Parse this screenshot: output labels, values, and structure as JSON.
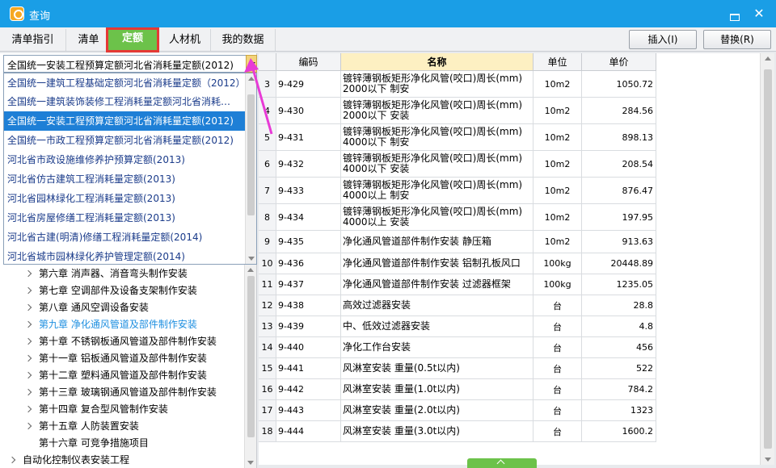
{
  "window": {
    "title": "查询"
  },
  "tabs": [
    {
      "label": "清单指引",
      "active": false
    },
    {
      "label": "清单",
      "active": false
    },
    {
      "label": "定额",
      "active": true
    },
    {
      "label": "人材机",
      "active": false
    },
    {
      "label": "我的数据",
      "active": false
    }
  ],
  "actions": {
    "insert": "插入(I)",
    "replace": "替换(R)"
  },
  "quota_library": {
    "selected": "全国统一安装工程预算定额河北省消耗量定额(2012)",
    "options": [
      "全国统一建筑工程基础定额河北省消耗量定额（2012）",
      "全国统一建筑装饰装修工程消耗量定额河北省消耗…",
      "全国统一安装工程预算定额河北省消耗量定额(2012)",
      "全国统一市政工程预算定额河北省消耗量定额(2012)",
      "河北省市政设施维修养护预算定额(2013)",
      "河北省仿古建筑工程消耗量定额(2013)",
      "河北省园林绿化工程消耗量定额(2013)",
      "河北省房屋修缮工程消耗量定额(2013)",
      "河北省古建(明清)修缮工程消耗量定额(2014)",
      "河北省城市园林绿化养护管理定额(2014)"
    ],
    "selected_index": 2
  },
  "tree": [
    {
      "label": "第六章 消声器、消音弯头制作安装",
      "expandable": true,
      "active": false
    },
    {
      "label": "第七章 空调部件及设备支架制作安装",
      "expandable": true,
      "active": false
    },
    {
      "label": "第八章 通风空调设备安装",
      "expandable": true,
      "active": false
    },
    {
      "label": "第九章 净化通风管道及部件制作安装",
      "expandable": true,
      "active": true
    },
    {
      "label": "第十章 不锈钢板通风管道及部件制作安装",
      "expandable": true,
      "active": false
    },
    {
      "label": "第十一章 铝板通风管道及部件制作安装",
      "expandable": true,
      "active": false
    },
    {
      "label": "第十二章 塑料通风管道及部件制作安装",
      "expandable": true,
      "active": false
    },
    {
      "label": "第十三章 玻璃钢通风管道及部件制作安装",
      "expandable": true,
      "active": false
    },
    {
      "label": "第十四章 复合型风管制作安装",
      "expandable": true,
      "active": false
    },
    {
      "label": "第十五章 人防装置安装",
      "expandable": true,
      "active": false
    },
    {
      "label": "第十六章 可竞争措施项目",
      "expandable": false,
      "active": false
    },
    {
      "label": "自动化控制仪表安装工程",
      "expandable": true,
      "active": false,
      "root": true
    }
  ],
  "table": {
    "columns": {
      "code": "编码",
      "name": "名称",
      "unit": "单位",
      "price": "单价"
    },
    "rows": [
      {
        "idx": "3",
        "code": "9-429",
        "name": "镀锌薄钢板矩形净化风管(咬口)周长(mm)\n2000以下 制安",
        "unit": "10m2",
        "price": "1050.72"
      },
      {
        "idx": "4",
        "code": "9-430",
        "name": "镀锌薄钢板矩形净化风管(咬口)周长(mm)\n2000以下 安装",
        "unit": "10m2",
        "price": "284.56"
      },
      {
        "idx": "5",
        "code": "9-431",
        "name": "镀锌薄钢板矩形净化风管(咬口)周长(mm)\n4000以下 制安",
        "unit": "10m2",
        "price": "898.13"
      },
      {
        "idx": "6",
        "code": "9-432",
        "name": "镀锌薄钢板矩形净化风管(咬口)周长(mm)\n4000以下 安装",
        "unit": "10m2",
        "price": "208.54"
      },
      {
        "idx": "7",
        "code": "9-433",
        "name": "镀锌薄钢板矩形净化风管(咬口)周长(mm)\n4000以上 制安",
        "unit": "10m2",
        "price": "876.47"
      },
      {
        "idx": "8",
        "code": "9-434",
        "name": "镀锌薄钢板矩形净化风管(咬口)周长(mm)\n4000以上 安装",
        "unit": "10m2",
        "price": "197.95"
      },
      {
        "idx": "9",
        "code": "9-435",
        "name": "净化通风管道部件制作安装 静压箱",
        "unit": "10m2",
        "price": "913.63"
      },
      {
        "idx": "10",
        "code": "9-436",
        "name": "净化通风管道部件制作安装 铝制孔板风口",
        "unit": "100kg",
        "price": "20448.89"
      },
      {
        "idx": "11",
        "code": "9-437",
        "name": "净化通风管道部件制作安装 过滤器框架",
        "unit": "100kg",
        "price": "1235.05"
      },
      {
        "idx": "12",
        "code": "9-438",
        "name": "高效过滤器安装",
        "unit": "台",
        "price": "28.8"
      },
      {
        "idx": "13",
        "code": "9-439",
        "name": "中、低效过滤器安装",
        "unit": "台",
        "price": "4.8"
      },
      {
        "idx": "14",
        "code": "9-440",
        "name": "净化工作台安装",
        "unit": "台",
        "price": "456"
      },
      {
        "idx": "15",
        "code": "9-441",
        "name": "风淋室安装 重量(0.5t以内)",
        "unit": "台",
        "price": "522"
      },
      {
        "idx": "16",
        "code": "9-442",
        "name": "风淋室安装 重量(1.0t以内)",
        "unit": "台",
        "price": "784.2"
      },
      {
        "idx": "17",
        "code": "9-443",
        "name": "风淋室安装 重量(2.0t以内)",
        "unit": "台",
        "price": "1323"
      },
      {
        "idx": "18",
        "code": "9-444",
        "name": "风淋室安装 重量(3.0t以内)",
        "unit": "台",
        "price": "1600.2"
      }
    ]
  },
  "colors": {
    "titlebar": "#1a9ee6",
    "active_tab": "#6cc24a",
    "highlight_border": "#e53935",
    "selection": "#1e7fd6",
    "arrow": "#e83ad6"
  },
  "icons": {
    "app": "query-app-icon",
    "minimize": "restore-icon",
    "close": "close-icon"
  }
}
